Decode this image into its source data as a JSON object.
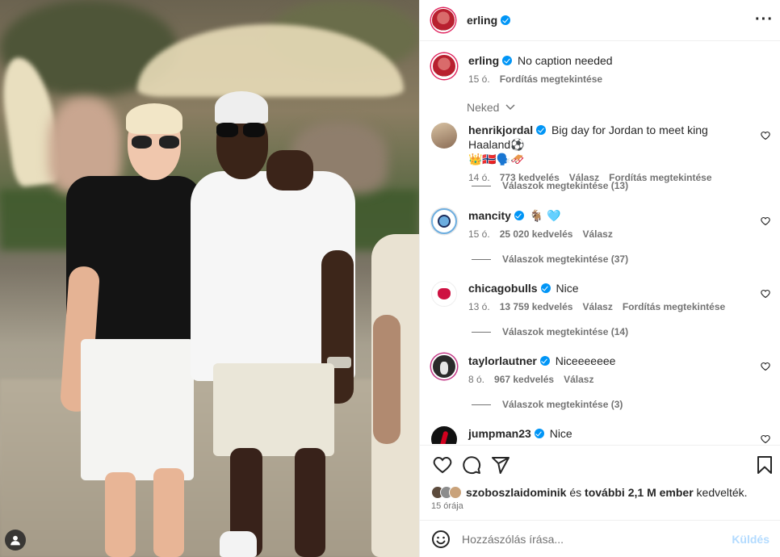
{
  "post": {
    "author": "erling",
    "caption": "No caption needed",
    "caption_age": "15 ó.",
    "translate_label": "Fordítás megtekintése"
  },
  "filter_label": "Neked",
  "comments": [
    {
      "user": "henrikjordal",
      "text": "Big day for Jordan to meet king Haaland⚽️",
      "text2": "👑🇳🇴🗣️🛷",
      "age": "14 ó.",
      "likes": "773 kedvelés",
      "reply": "Válasz",
      "translate": "Fordítás megtekintése",
      "replies": "Válaszok megtekintése (13)"
    },
    {
      "user": "mancity",
      "text": "🐐 🩵",
      "age": "15 ó.",
      "likes": "25 020 kedvelés",
      "reply": "Válasz",
      "replies": "Válaszok megtekintése (37)"
    },
    {
      "user": "chicagobulls",
      "text": "Nice",
      "age": "13 ó.",
      "likes": "13 759 kedvelés",
      "reply": "Válasz",
      "translate": "Fordítás megtekintése",
      "replies": "Válaszok megtekintése (14)"
    },
    {
      "user": "taylorlautner",
      "text": "Niceeeeeee",
      "age": "8 ó.",
      "likes": "967 kedvelés",
      "reply": "Válasz",
      "replies": "Válaszok megtekintése (3)"
    },
    {
      "user": "jumpman23",
      "text": "Nice"
    }
  ],
  "likes": {
    "user": "szoboszlaidominik",
    "and": "és",
    "others": "további 2,1 M ember",
    "suffix": "kedvelték."
  },
  "post_age": "15 órája",
  "comment_input": {
    "placeholder": "Hozzászólás írása...",
    "send": "Küldés"
  },
  "icons": [
    "more-icon",
    "heart-icon",
    "comment-icon",
    "share-icon",
    "bookmark-icon",
    "emoji-icon",
    "user-tag-icon"
  ],
  "colors": {
    "verified": "#0095f6",
    "send_disabled": "#b3dbff",
    "secondary_text": "#737373"
  }
}
